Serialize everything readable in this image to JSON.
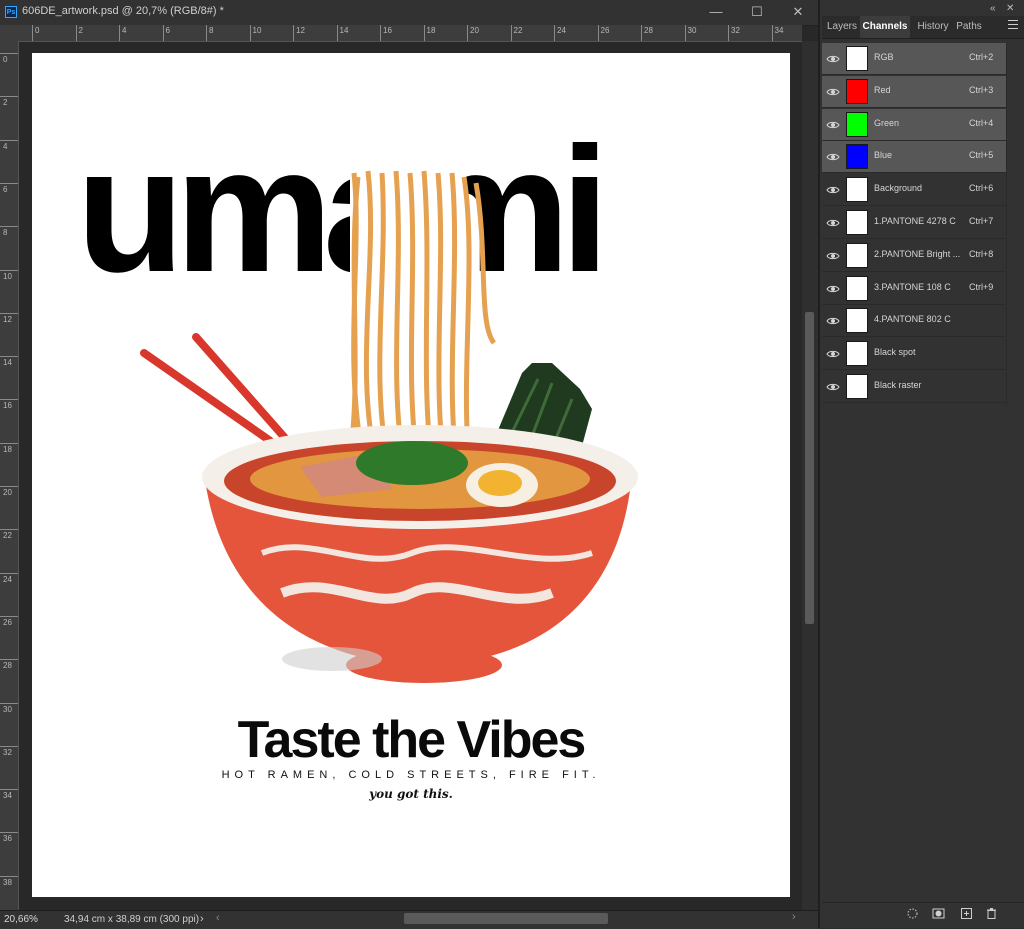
{
  "document": {
    "tab_title": "606DE_artwork.psd @ 20,7% (RGB/8#) *",
    "app_badge": "Ps",
    "window_buttons": {
      "minimize": "—",
      "maximize": "☐",
      "close": "✕"
    }
  },
  "rulers": {
    "horizontal": [
      "0",
      "2",
      "4",
      "6",
      "8",
      "10",
      "12",
      "14",
      "16",
      "18",
      "20",
      "22",
      "24",
      "26",
      "28",
      "30",
      "32",
      "34"
    ],
    "vertical": [
      "0",
      "2",
      "4",
      "6",
      "8",
      "10",
      "12",
      "14",
      "16",
      "18",
      "20",
      "22",
      "24",
      "26",
      "28",
      "30",
      "32",
      "34",
      "36",
      "38"
    ]
  },
  "artwork": {
    "headline": "umami",
    "tagline": "Taste the Vibes",
    "subline": "HOT RAMEN, COLD STREETS, FIRE FIT.",
    "script": "you got this."
  },
  "status": {
    "zoom": "20,66%",
    "doc_info": "34,94 cm x 38,89 cm (300 ppi)",
    "arrow": "›"
  },
  "panel": {
    "tabs": [
      "Layers",
      "Channels",
      "History",
      "Paths"
    ],
    "active_tab": "Channels",
    "collapse_icon": "«",
    "close_icon": "✕",
    "channels": [
      {
        "name": "RGB",
        "shortcut": "Ctrl+2",
        "selected": true,
        "thumb_color": "#ffffff"
      },
      {
        "name": "Red",
        "shortcut": "Ctrl+3",
        "selected": true,
        "thumb_color": "#ff0000"
      },
      {
        "name": "Green",
        "shortcut": "Ctrl+4",
        "selected": true,
        "thumb_color": "#00ff00"
      },
      {
        "name": "Blue",
        "shortcut": "Ctrl+5",
        "selected": true,
        "thumb_color": "#0000ff"
      },
      {
        "name": "Background",
        "shortcut": "Ctrl+6",
        "selected": false,
        "thumb_color": "#ffffff"
      },
      {
        "name": "1.PANTONE 4278 C",
        "shortcut": "Ctrl+7",
        "selected": false,
        "thumb_color": "#ffffff"
      },
      {
        "name": "2.PANTONE Bright ...",
        "shortcut": "Ctrl+8",
        "selected": false,
        "thumb_color": "#ffffff"
      },
      {
        "name": "3.PANTONE 108 C",
        "shortcut": "Ctrl+9",
        "selected": false,
        "thumb_color": "#ffffff"
      },
      {
        "name": "4.PANTONE 802 C",
        "shortcut": "",
        "selected": false,
        "thumb_color": "#ffffff"
      },
      {
        "name": "Black spot",
        "shortcut": "",
        "selected": false,
        "thumb_color": "#ffffff"
      },
      {
        "name": "Black raster",
        "shortcut": "",
        "selected": false,
        "thumb_color": "#ffffff"
      }
    ],
    "footer_icons": [
      "load-selection-icon",
      "save-selection-icon",
      "new-channel-icon",
      "delete-channel-icon"
    ]
  },
  "colors": {
    "bowl_red": "#e4553b",
    "noodle": "#e8a85a",
    "nori": "#1f3a1f",
    "chopsticks": "#d9372b",
    "selected_row": "#575757",
    "ps_blue": "#31a8ff"
  }
}
